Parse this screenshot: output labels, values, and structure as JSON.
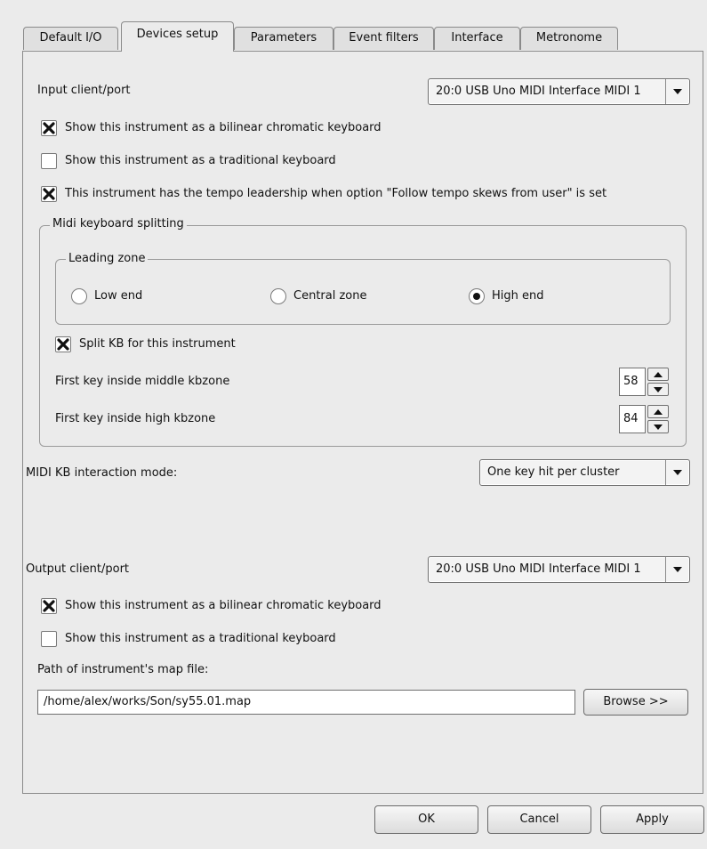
{
  "tabs": [
    "Default I/O",
    "Devices setup",
    "Parameters",
    "Event filters",
    "Interface",
    "Metronome"
  ],
  "input": {
    "label": "Input client/port",
    "port_value": "20:0 USB Uno MIDI Interface MIDI 1",
    "chk_bilinear": "Show this instrument as a bilinear chromatic keyboard",
    "chk_traditional": "Show this instrument as a traditional keyboard",
    "chk_tempo": "This instrument has the tempo leadership when option \"Follow tempo skews from user\" is set"
  },
  "splitting": {
    "title": "Midi keyboard splitting",
    "leading_zone_title": "Leading zone",
    "radio_low": "Low end",
    "radio_central": "Central zone",
    "radio_high": "High end",
    "chk_split": "Split KB for this instrument",
    "middle_label": "First key inside middle kbzone",
    "middle_value": "58",
    "high_label": "First key inside high kbzone",
    "high_value": "84"
  },
  "interaction": {
    "label": "MIDI KB interaction mode:",
    "value": "One key hit per cluster"
  },
  "output": {
    "label": "Output client/port",
    "port_value": "20:0 USB Uno MIDI Interface MIDI 1",
    "chk_bilinear": "Show this instrument as a bilinear chromatic keyboard",
    "chk_traditional": "Show this instrument as a traditional keyboard",
    "map_label": "Path of instrument's map file:",
    "map_path": "/home/alex/works/Son/sy55.01.map",
    "browse": "Browse >>"
  },
  "buttons": {
    "ok": "OK",
    "cancel": "Cancel",
    "apply": "Apply"
  }
}
